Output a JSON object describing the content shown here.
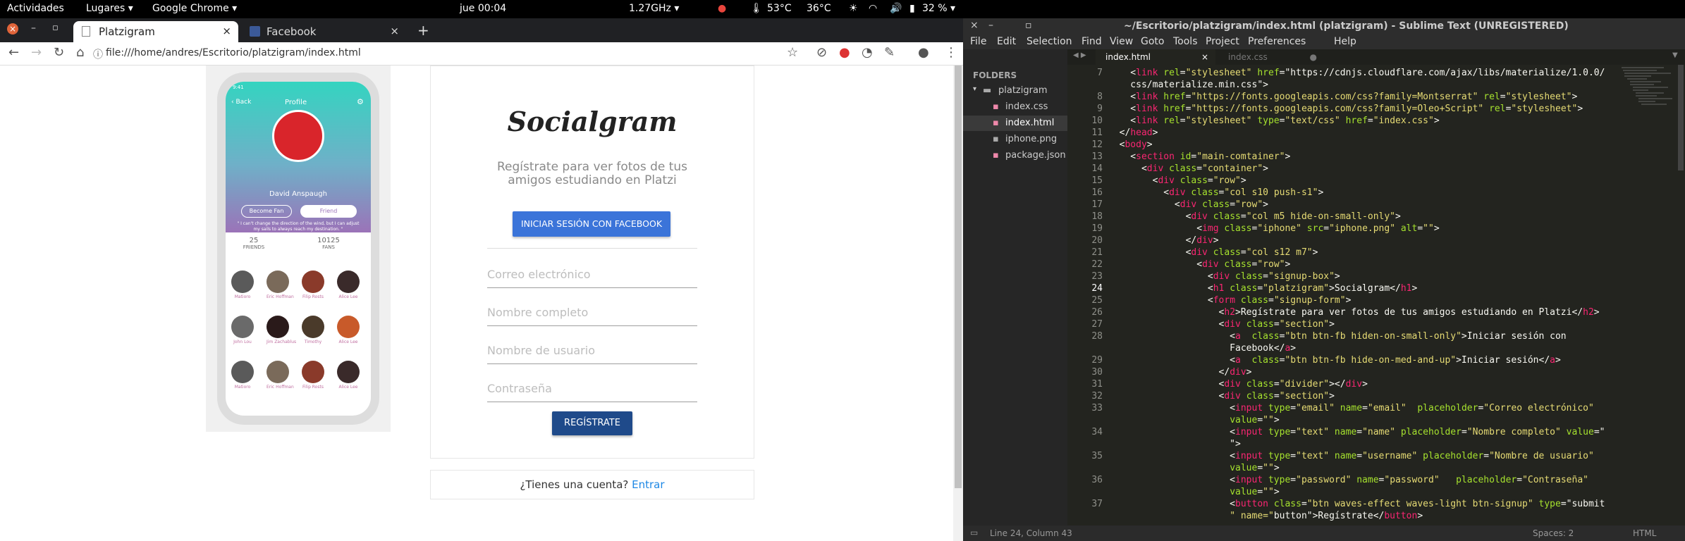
{
  "topbar": {
    "activities": "Actividades",
    "places": "Lugares ▾",
    "app": "Google Chrome ▾",
    "clock": "jue 00:04",
    "cpu": "1.27GHz ▾",
    "temp1": "53°C",
    "temp2": "36°C",
    "battery": "32 % ▾"
  },
  "chrome": {
    "tabs": [
      {
        "title": "Platzigram",
        "close": "×"
      },
      {
        "title": "Facebook",
        "close": "×"
      }
    ],
    "new_tab": "+",
    "url": "file:///home/andres/Escritorio/platzigram/index.html"
  },
  "phone": {
    "time": "9:41",
    "back": "Back",
    "header": "Profile",
    "name": "David Anspaugh",
    "become_fan": "Become Fan",
    "friend": "Friend",
    "quote": "\" I can't change the direction of the wind, but I can adjust my sails to always reach my destination. \"",
    "stats": [
      {
        "value": "25",
        "label": "FRIENDS"
      },
      {
        "value": "10125",
        "label": "FANS"
      }
    ],
    "friends": [
      "Matioro",
      "Eric Hoffman",
      "Filip Rosts",
      "Alice Lee",
      "John Lou",
      "Jim Zachablus",
      "Timothy",
      "Alice Lee",
      "Matioro",
      "Eric Hoffman",
      "Filip Rosts",
      "Alice Lee"
    ]
  },
  "signup": {
    "brand": "Socialgram",
    "tagline": "Regístrate para ver fotos de tus amigos estudiando en Platzi",
    "fb_button": "INICIAR SESIÓN CON FACEBOOK",
    "fields": [
      "Correo electrónico",
      "Nombre completo",
      "Nombre de usuario",
      "Contraseña"
    ],
    "register_button": "REGÍSTRATE",
    "login_prompt": "¿Tienes una cuenta?",
    "login_link": "Entrar"
  },
  "sublime": {
    "title": "~/Escritorio/platzigram/index.html (platzigram) - Sublime Text (UNREGISTERED)",
    "menu": [
      "File",
      "Edit",
      "Selection",
      "Find",
      "View",
      "Goto",
      "Tools",
      "Project",
      "Preferences",
      "Help"
    ],
    "folders_label": "FOLDERS",
    "project": "platzigram",
    "files": [
      "index.css",
      "index.html",
      "iphone.png",
      "package.json"
    ],
    "tabs": [
      "index.html",
      "index.css"
    ],
    "status_left": "Line 24, Column 43",
    "status_spaces": "Spaces: 2",
    "status_syntax": "HTML"
  },
  "code_lines": [
    {
      "n": "7",
      "text": "    <link rel=\"stylesheet\" href=\"https://cdnjs.cloudflare.com/ajax/libs/materialize/1.0.0/"
    },
    {
      "n": "",
      "text": "    css/materialize.min.css\">"
    },
    {
      "n": "8",
      "text": "    <link href=\"https://fonts.googleapis.com/css?family=Montserrat\" rel=\"stylesheet\">"
    },
    {
      "n": "9",
      "text": "    <link href=\"https://fonts.googleapis.com/css?family=Oleo+Script\" rel=\"stylesheet\">"
    },
    {
      "n": "10",
      "text": "    <link rel=\"stylesheet\" type=\"text/css\" href=\"index.css\">"
    },
    {
      "n": "11",
      "text": "  </head>"
    },
    {
      "n": "12",
      "text": "  <body>"
    },
    {
      "n": "13",
      "text": "    <section id=\"main-comtainer\">"
    },
    {
      "n": "14",
      "text": "      <div class=\"container\">"
    },
    {
      "n": "15",
      "text": "        <div class=\"row\">"
    },
    {
      "n": "16",
      "text": "          <div class=\"col s10 push-s1\">"
    },
    {
      "n": "17",
      "text": "            <div class=\"row\">"
    },
    {
      "n": "18",
      "text": "              <div class=\"col m5 hide-on-small-only\">"
    },
    {
      "n": "19",
      "text": "                <img class=\"iphone\" src=\"iphone.png\" alt=\"\">"
    },
    {
      "n": "20",
      "text": "              </div>"
    },
    {
      "n": "21",
      "text": "              <div class=\"col s12 m7\">"
    },
    {
      "n": "22",
      "text": "                <div class=\"row\">"
    },
    {
      "n": "23",
      "text": "                  <div class=\"signup-box\">"
    },
    {
      "n": "24",
      "text": "                  <h1 class=\"platzigram\">Socialgram</h1>"
    },
    {
      "n": "25",
      "text": "                  <form class=\"signup-form\">"
    },
    {
      "n": "26",
      "text": "                    <h2>Regístrate para ver fotos de tus amigos estudiando en Platzi</h2>"
    },
    {
      "n": "27",
      "text": "                    <div class=\"section\">"
    },
    {
      "n": "28",
      "text": "                      <a  class=\"btn btn-fb hiden-on-small-only\">Iniciar sesión con"
    },
    {
      "n": "",
      "text": "                      Facebook</a>"
    },
    {
      "n": "29",
      "text": "                      <a  class=\"btn btn-fb hide-on-med-and-up\">Iniciar sesión</a>"
    },
    {
      "n": "30",
      "text": "                    </div>"
    },
    {
      "n": "31",
      "text": "                    <div class=\"divider\"></div>"
    },
    {
      "n": "32",
      "text": "                    <div class=\"section\">"
    },
    {
      "n": "33",
      "text": "                      <input type=\"email\" name=\"email\"  placeholder=\"Correo electrónico\""
    },
    {
      "n": "",
      "text": "                      value=\"\">"
    },
    {
      "n": "34",
      "text": "                      <input type=\"text\" name=\"name\" placeholder=\"Nombre completo\" value=\""
    },
    {
      "n": "",
      "text": "                      \">"
    },
    {
      "n": "35",
      "text": "                      <input type=\"text\" name=\"username\" placeholder=\"Nombre de usuario\""
    },
    {
      "n": "",
      "text": "                      value=\"\">"
    },
    {
      "n": "36",
      "text": "                      <input type=\"password\" name=\"password\"   placeholder=\"Contraseña\""
    },
    {
      "n": "",
      "text": "                      value=\"\">"
    },
    {
      "n": "37",
      "text": "                      <button class=\"btn waves-effect waves-light btn-signup\" type=\"submit"
    },
    {
      "n": "",
      "text": "                      \" name=\"button\">Regístrate</button>"
    }
  ]
}
